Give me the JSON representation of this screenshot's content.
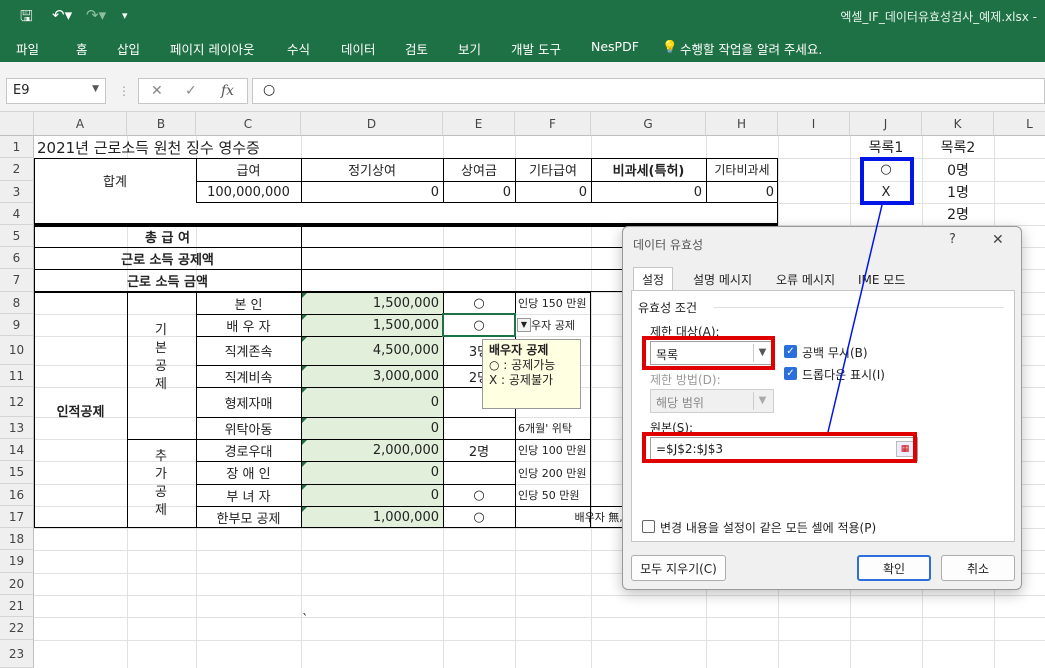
{
  "titlebar": {
    "filename": "엑셀_IF_데이터유효성검사_예제.xlsx -"
  },
  "ribbon": {
    "tabs": [
      "파일",
      "홈",
      "삽입",
      "페이지 레이아웃",
      "수식",
      "데이터",
      "검토",
      "보기",
      "개발 도구",
      "NesPDF"
    ],
    "tellme": "수행할 작업을 알려 주세요."
  },
  "formula_bar": {
    "namebox": "E9",
    "fx": "fx",
    "value": "○"
  },
  "columns": [
    "A",
    "B",
    "C",
    "D",
    "E",
    "F",
    "G",
    "H",
    "I",
    "J",
    "K",
    "L"
  ],
  "rows": [
    "1",
    "2",
    "3",
    "4",
    "5",
    "6",
    "7",
    "8",
    "9",
    "10",
    "11",
    "12",
    "13",
    "14",
    "15",
    "16",
    "17",
    "18",
    "19",
    "20",
    "21",
    "22",
    "23"
  ],
  "sheet": {
    "a1": "2021년 근로소득 원천 징수 영수증",
    "total_label": "합계",
    "hdr_salary": "급여",
    "hdr_regular": "정기상여",
    "hdr_bonus": "상여금",
    "hdr_other": "기타급여",
    "hdr_taxfree": "비과세(특허)",
    "hdr_other_taxfree": "기타비과세",
    "v_salary": "100,000,000",
    "v_regular": "0",
    "v_bonus": "0",
    "v_other": "0",
    "v_taxfree": "0",
    "v_other_taxfree": "0",
    "total_pay": "총 급 여",
    "deduction": "근로 소득 공제액",
    "income": "근로 소득 금액",
    "personal": "인적공제",
    "basic": "기본공제",
    "additional": "추가공제",
    "items": [
      {
        "name": "본   인",
        "amt": "1,500,000",
        "e": "○",
        "f": "인당 150 만원"
      },
      {
        "name": "배 우 자",
        "amt": "1,500,000",
        "e": "○",
        "f": "우자 공제"
      },
      {
        "name": "직계존속",
        "amt": "4,500,000",
        "e": "3명",
        "f": ""
      },
      {
        "name": "직계비속",
        "amt": "3,000,000",
        "e": "2명",
        "f": ""
      },
      {
        "name": "형제자매",
        "amt": "0",
        "e": "",
        "f": "세"
      },
      {
        "name": "위탁아동",
        "amt": "0",
        "e": "",
        "f": "6개월' 위탁"
      },
      {
        "name": "경로우대",
        "amt": "2,000,000",
        "e": "2명",
        "f": "인당 100 만원"
      },
      {
        "name": "장 애 인",
        "amt": "0",
        "e": "",
        "f": "인당 200 만원"
      },
      {
        "name": "부 녀 자",
        "amt": "0",
        "e": "○",
        "f": "인당 50 만원"
      },
      {
        "name": "한부모 공제",
        "amt": "1,000,000",
        "e": "○",
        "f": "배우자 無, 직계"
      }
    ],
    "list1_header": "목록1",
    "list2_header": "목록2",
    "list1": [
      "○",
      "X"
    ],
    "list2": [
      "0명",
      "1명",
      "2명"
    ],
    "backtick": "`"
  },
  "tooltip": {
    "title": "배우자 공제",
    "line1": "○ : 공제가능",
    "line2": "X : 공제불가"
  },
  "dialog": {
    "title": "데이터 유효성",
    "help": "?",
    "close": "✕",
    "tabs": [
      "설정",
      "설명 메시지",
      "오류 메시지",
      "IME 모드"
    ],
    "section": "유효성 조건",
    "allow_label": "제한 대상(A):",
    "allow_value": "목록",
    "ignore_blank": "공백 무시(B)",
    "dropdown": "드롭다운 표시(I)",
    "data_label": "제한 방법(D):",
    "data_value": "해당 범위",
    "source_label": "원본(S):",
    "source_value": "=$J$2:$J$3",
    "apply_all": "변경 내용을 설정이 같은 모든 셀에 적용(P)",
    "clear_all": "모두 지우기(C)",
    "ok": "확인",
    "cancel": "취소"
  },
  "colors": {
    "excel_green": "#1e7145",
    "highlight_red": "#e00000",
    "highlight_blue": "#0015e6",
    "input_green": "#e2efda"
  }
}
